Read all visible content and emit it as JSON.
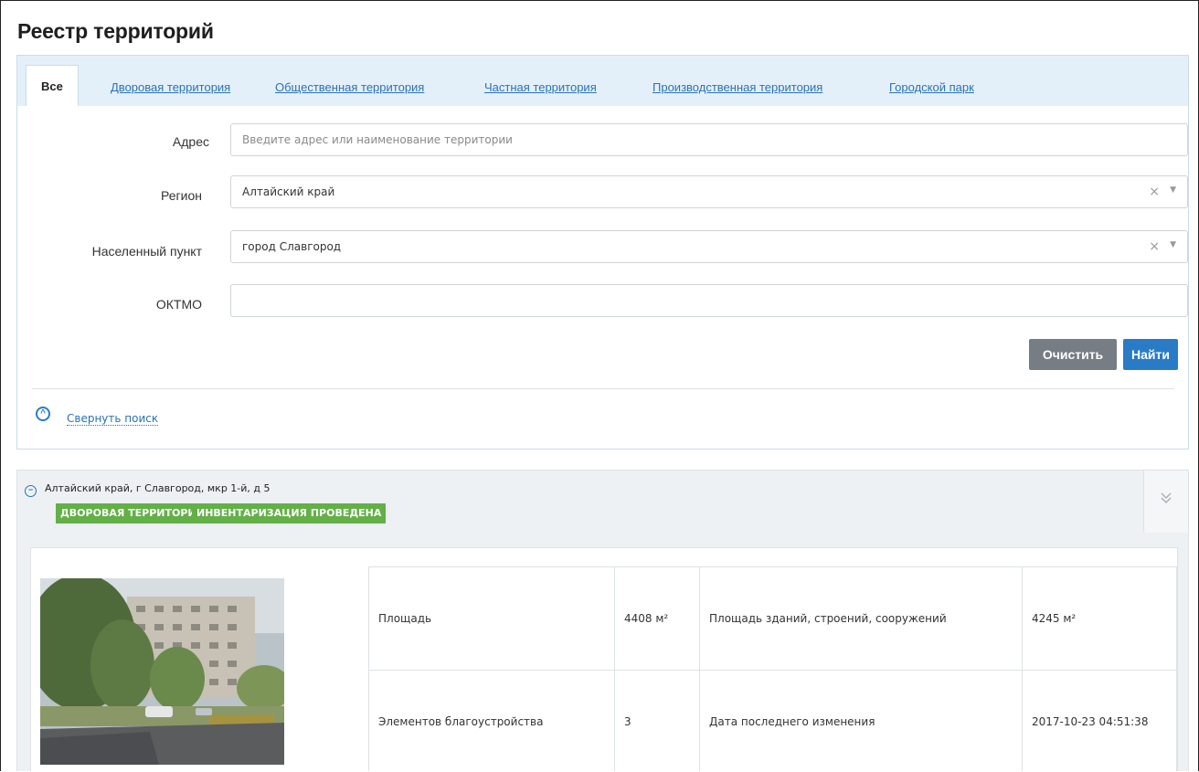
{
  "page": {
    "title": "Реестр территорий"
  },
  "tabs": [
    {
      "label": "Все",
      "active": true
    },
    {
      "label": "Дворовая территория"
    },
    {
      "label": "Общественная территория"
    },
    {
      "label": "Частная территория"
    },
    {
      "label": "Производственная территория"
    },
    {
      "label": "Городской парк"
    }
  ],
  "form": {
    "address": {
      "label": "Адрес",
      "placeholder": "Введите адрес или наименование территории"
    },
    "region": {
      "label": "Регион",
      "value": "Алтайский край"
    },
    "locality": {
      "label": "Населенный пункт",
      "value": "город Славгород"
    },
    "oktmo": {
      "label": "ОКТМО",
      "value": ""
    },
    "clear_label": "Очистить",
    "find_label": "Найти",
    "collapse_label": "Свернуть поиск",
    "clear_symbol": "×",
    "caret_symbol": "▼"
  },
  "result": {
    "address": "Алтайский край, г Славгород, мкр 1-й, д 5",
    "badges": [
      "ДВОРОВАЯ ТЕРРИТОРИЯ",
      "ИНВЕНТАРИЗАЦИЯ ПРОВЕДЕНА"
    ],
    "badge_color": "#62b046",
    "rows": [
      {
        "k1": "Площадь",
        "v1": "4408 м²",
        "k2": "Площадь зданий, строений, сооружений",
        "v2": "4245 м²"
      },
      {
        "k1": "Элементов благоустройства",
        "v1": "3",
        "k2": "Дата последнего изменения",
        "v2": "2017-10-23 04:51:38"
      }
    ]
  },
  "colors": {
    "accent": "#2a7bc6",
    "tabbar": "#e4f0f9",
    "clear_button": "#767d84"
  }
}
